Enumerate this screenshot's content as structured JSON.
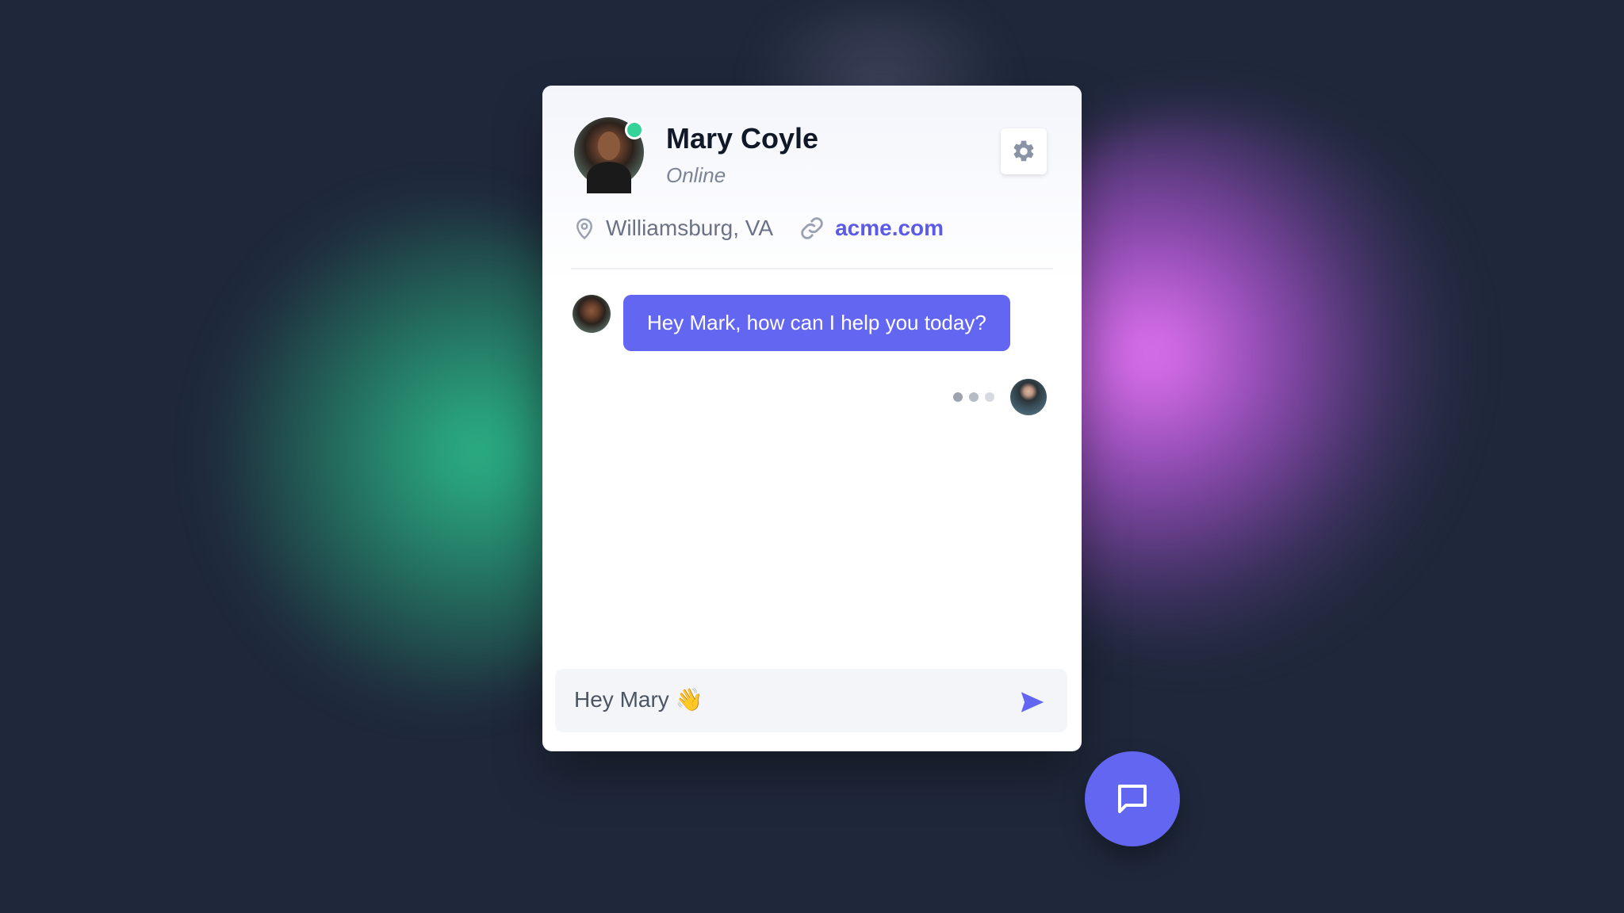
{
  "contact": {
    "name": "Mary Coyle",
    "status": "Online",
    "location": "Williamsburg, VA",
    "website": "acme.com"
  },
  "messages": [
    {
      "from": "Mary Coyle",
      "text": "Hey Mark, how can I help you today?"
    }
  ],
  "composer": {
    "value": "Hey Mary 👋"
  },
  "icons": {
    "settings": "gear-icon",
    "location": "location-pin-icon",
    "link": "link-icon",
    "send": "send-icon",
    "chat_launcher": "chat-bubble-icon"
  },
  "colors": {
    "accent": "#6366f1",
    "online": "#34d399",
    "background": "#1f283b"
  }
}
